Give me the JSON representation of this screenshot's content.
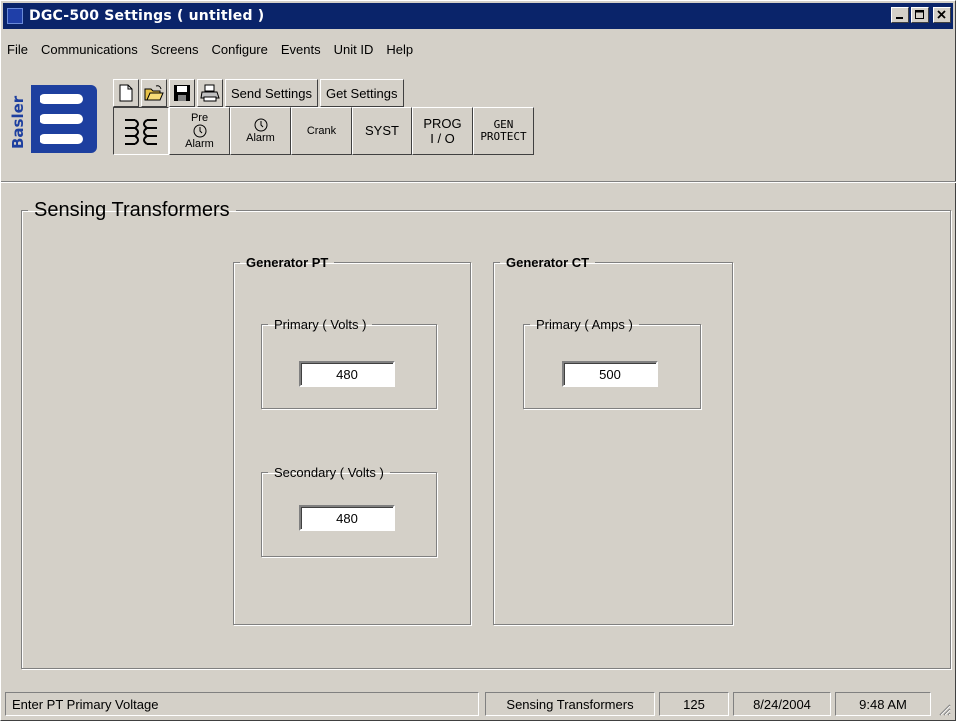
{
  "window": {
    "title": "DGC-500 Settings   ( untitled )",
    "caption_buttons": [
      "minimize-icon",
      "maximize-icon",
      "close-icon"
    ]
  },
  "menu": [
    "File",
    "Communications",
    "Screens",
    "Configure",
    "Events",
    "Unit ID",
    "Help"
  ],
  "toolbar": {
    "logo_text": "Basler",
    "icons": [
      "new-file-icon",
      "open-folder-icon",
      "save-disk-icon",
      "print-icon"
    ],
    "send_label": "Send Settings",
    "get_label": "Get Settings"
  },
  "screens": {
    "pre_alarm": [
      "Pre",
      "Alarm"
    ],
    "alarm": "Alarm",
    "crank": "Crank",
    "syst": "SYST",
    "prog": [
      "PROG",
      "I / O"
    ],
    "gen_protect": [
      "GEN",
      "PROTECT"
    ]
  },
  "main": {
    "title": "Sensing Transformers",
    "pt": {
      "title": "Generator PT",
      "primary_label": "Primary ( Volts )",
      "primary_value": "480",
      "secondary_label": "Secondary ( Volts )",
      "secondary_value": "480"
    },
    "ct": {
      "title": "Generator CT",
      "primary_label": "Primary ( Amps )",
      "primary_value": "500"
    }
  },
  "status": {
    "hint": "Enter PT Primary Voltage",
    "screen": "Sensing Transformers",
    "unit": "125",
    "date": "8/24/2004",
    "time": "9:48 AM"
  },
  "colors": {
    "title_bar": "#0a246a",
    "face": "#d4d0c8",
    "logo_blue": "#1d3f9f"
  }
}
